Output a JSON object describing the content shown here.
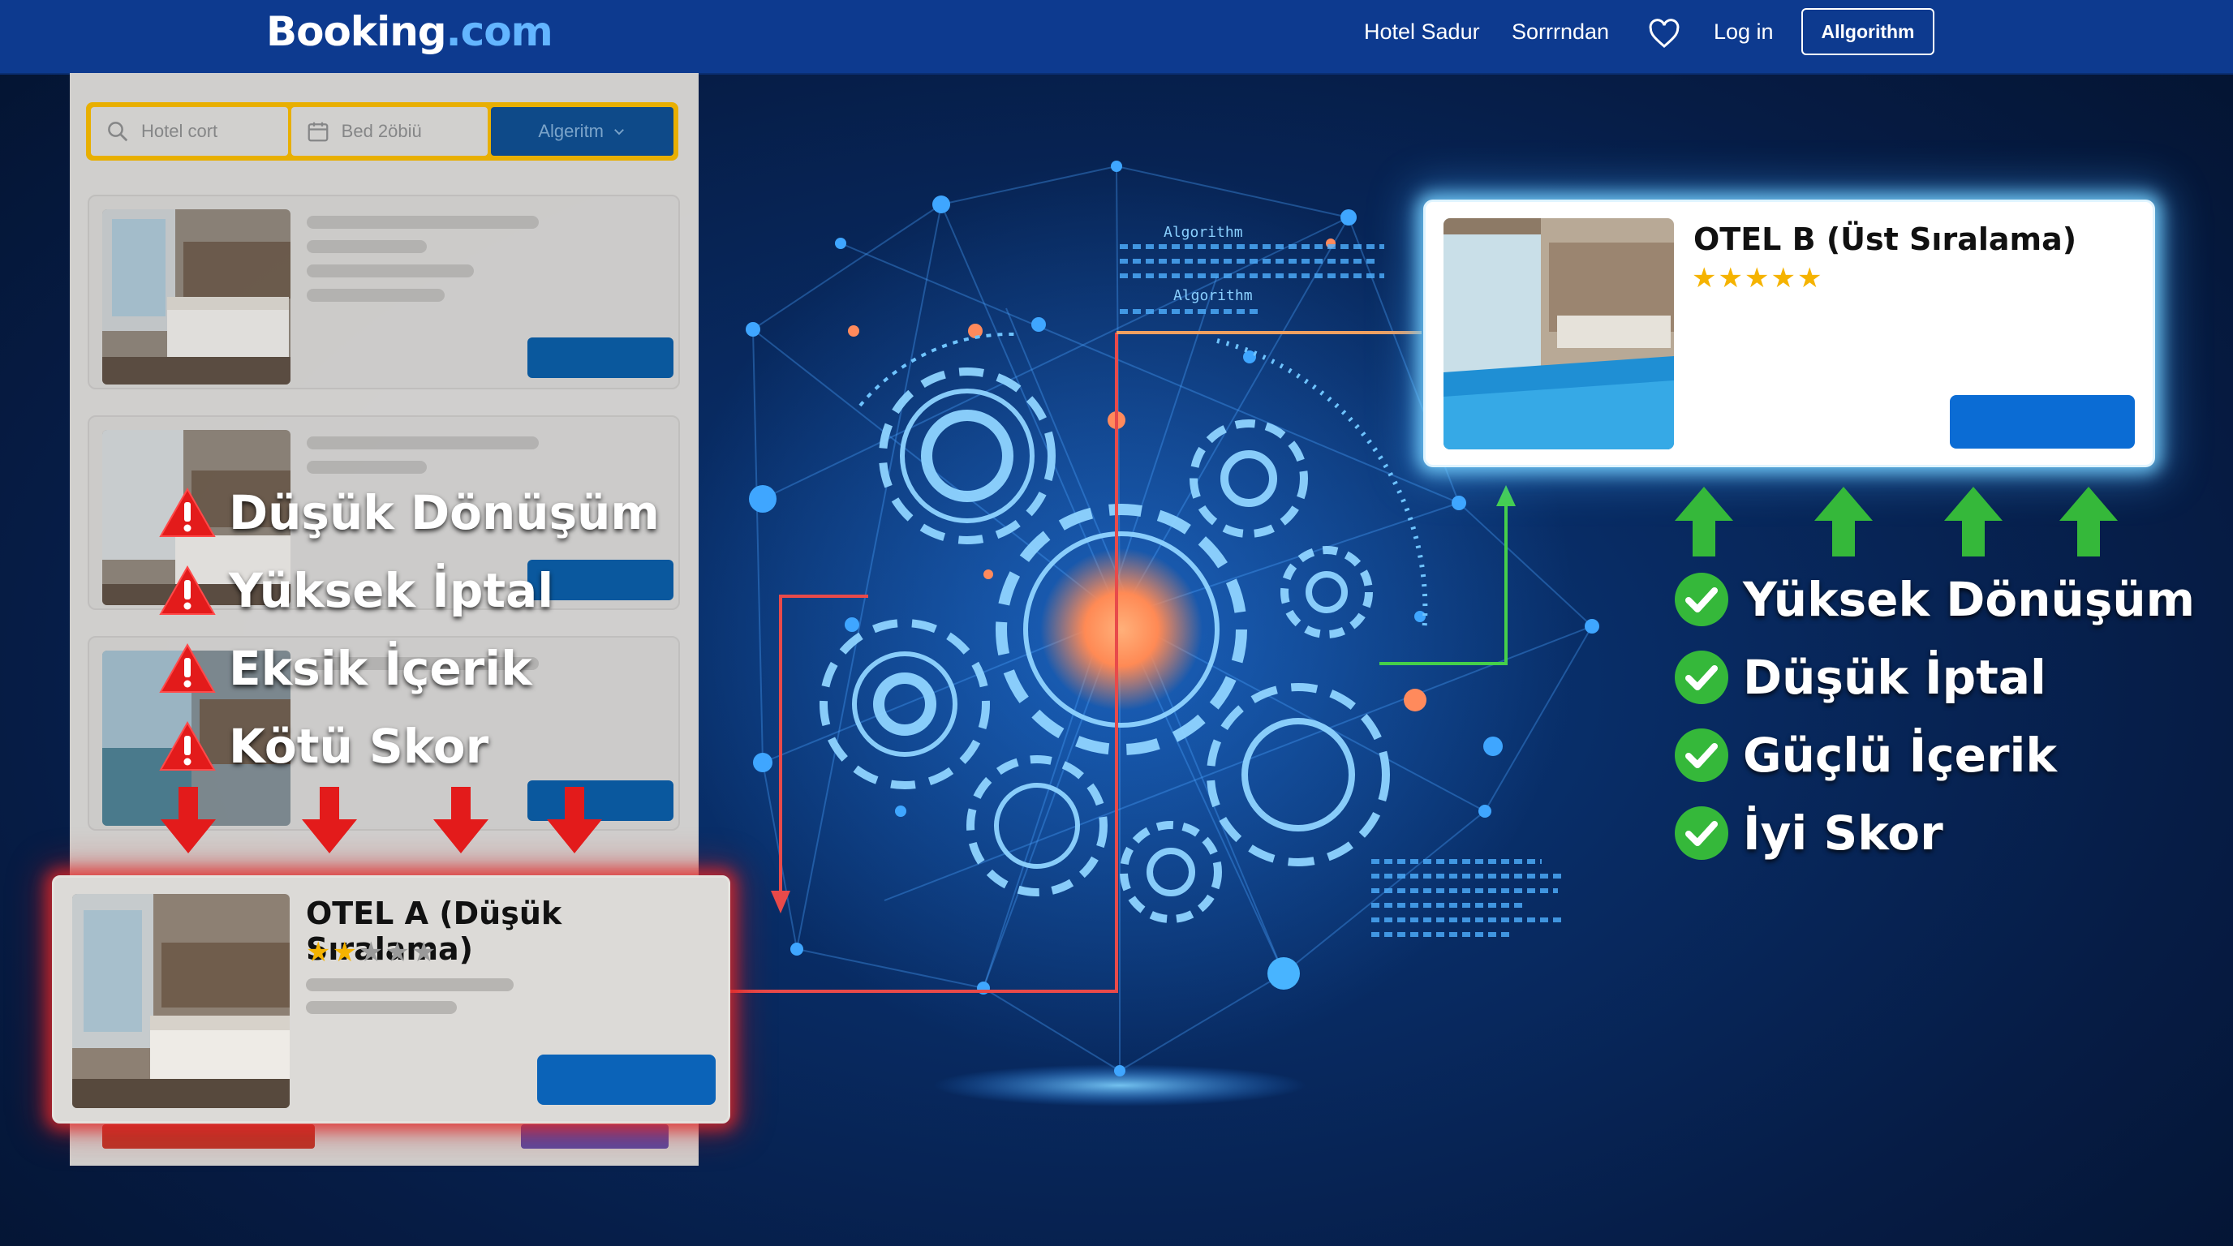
{
  "header": {
    "logo_main": "Booking",
    "logo_tld": ".com",
    "nav_links": [
      "Hotel Sadur",
      "Sorrrndan"
    ],
    "login_label": "Log in",
    "algorithm_button": "Allgorithm"
  },
  "search": {
    "hotel_placeholder": "Hotel cort",
    "date_placeholder": "Bed 2öbiü",
    "algorithm_label": "Algeritm"
  },
  "hotel_a": {
    "title": "OTEL A (Düşük Sıralama)",
    "rating": 2,
    "rating_max": 5
  },
  "hotel_b": {
    "title": "OTEL B (Üst Sıralama)",
    "rating": 5,
    "rating_max": 5
  },
  "negative_factors": [
    "Düşük Dönüşüm",
    "Yüksek İptal",
    "Eksik İçerik",
    "Kötü Skor"
  ],
  "positive_factors": [
    "Yüksek Dönüşüm",
    "Düşük İptal",
    "Güçlü İçerik",
    "İyi Skor"
  ],
  "algorithm_panel": {
    "label_1": "Algorithm",
    "label_2": "Algorithm"
  },
  "colors": {
    "nav_bg": "#0d3a8f",
    "background": "#061c45",
    "cta_blue": "#0b63b8",
    "search_border": "#f0b400",
    "negative_red": "#e02424",
    "positive_green": "#3cc13b",
    "star_gold": "#f5b301",
    "star_grey": "#9a9a9a"
  },
  "icons": [
    "search-icon",
    "calendar-icon",
    "chevron-down-icon",
    "heart-icon",
    "warning-icon",
    "check-icon",
    "arrow-down-icon",
    "arrow-up-icon",
    "gear-icon"
  ]
}
